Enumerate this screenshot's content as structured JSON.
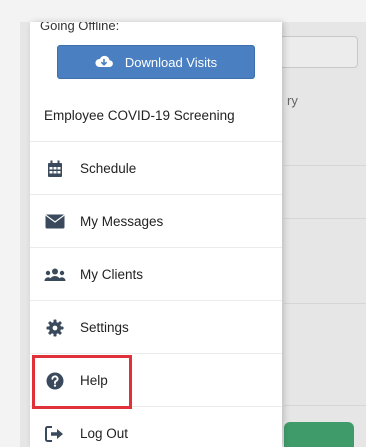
{
  "drawer": {
    "status_line": "Going Offline:",
    "download_button_label": "Download Visits",
    "items": [
      {
        "label": "Employee COVID-19 Screening",
        "icon": "none"
      },
      {
        "label": "Schedule",
        "icon": "calendar-icon"
      },
      {
        "label": "My Messages",
        "icon": "envelope-icon"
      },
      {
        "label": "My Clients",
        "icon": "users-icon"
      },
      {
        "label": "Settings",
        "icon": "gear-icon"
      },
      {
        "label": "Help",
        "icon": "question-circle-icon"
      },
      {
        "label": "Log Out",
        "icon": "sign-out-icon"
      }
    ]
  },
  "background": {
    "partial_text": "ry"
  },
  "colors": {
    "accent_blue": "#4a7fc1",
    "icon_dark": "#3a4a5c",
    "highlight_red": "#e0303a",
    "bottom_green": "#3f9c6a"
  }
}
